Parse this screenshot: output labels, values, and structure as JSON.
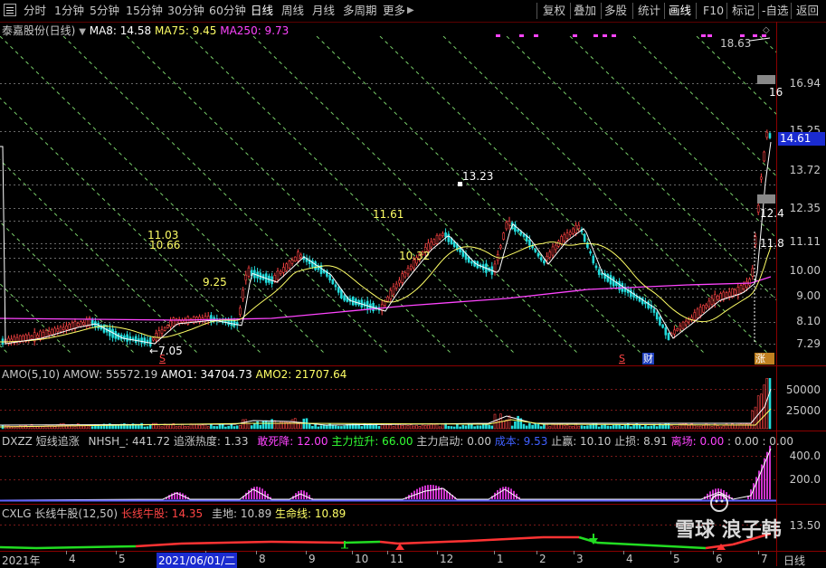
{
  "toolbar": {
    "menu_icon": "menu-icon",
    "periods": [
      "分时",
      "1分钟",
      "5分钟",
      "15分钟",
      "30分钟",
      "60分钟",
      "日线",
      "周线",
      "月线",
      "多周期",
      "更多"
    ],
    "active_period": "日线",
    "more_chevron": "chevron-right-icon",
    "right_buttons": [
      "复权",
      "叠加",
      "多股",
      "统计",
      "画线",
      "F10",
      "标记",
      "-自选",
      "返回"
    ],
    "active_right": "画线"
  },
  "main_panel": {
    "stock_title": "泰嘉股份(日线)",
    "ma8": "MA8: 14.58",
    "ma75": "MA75: 9.45",
    "ma250": "MA250: 9.73",
    "price_labels": [
      "16.94",
      "15.25",
      "13.72",
      "12.35",
      "11.11",
      "10.00",
      "9.00",
      "8.10",
      "7.29"
    ],
    "current_price": "14.61",
    "annotations": {
      "high": "18.63",
      "h1323": "13.23",
      "h1161": "11.61",
      "h1103": "11.03",
      "h1066": "10.66",
      "h1032": "10.32",
      "h925": "9.25",
      "low": "7.05",
      "p16": "16",
      "p124": "12.4",
      "p118": "11.8"
    },
    "badges": [
      "S",
      "S",
      "财",
      "涨"
    ],
    "colors": {
      "ma8": "#ffffff",
      "ma75": "#ffff66",
      "ma250": "#ff44ff",
      "up": "#ff4444",
      "down": "#22dddd"
    }
  },
  "amo_panel": {
    "title": "AMO(5,10)",
    "amow": "AMOW: 55572.19",
    "amo1": "AMO1: 34704.73",
    "amo2": "AMO2: 21707.64",
    "ticks": [
      "50000",
      "25000"
    ]
  },
  "dxzz_panel": {
    "title": "DXZZ 短线追涨",
    "nhsh": "NHSH_: 441.72",
    "heat": "追涨热度: 1.33",
    "dead_drop": "敢死降: 12.00",
    "main_pull": "主力拉升: 66.00",
    "main_start": "主力启动: 0.00",
    "cost": "成本: 9.53",
    "take_profit": "止赢: 10.10",
    "stop_loss": "止损: 8.91",
    "leave": "离场: 0.00",
    "zeros": ": 0.00 : 0.00",
    "ticks": [
      "400.0",
      "200.0"
    ]
  },
  "cxlg_panel": {
    "title": "CXLG 长线牛股(12,50)",
    "bull": "长线牛股: 14.35",
    "ground": "圭地: 10.89",
    "life": "生命线: 10.89",
    "ticks": [
      "13.50"
    ]
  },
  "x_axis": {
    "labels": [
      "2021年",
      "4",
      "5",
      "2021/06/01/二",
      "8",
      "9",
      "10",
      "11",
      "12",
      "1",
      "2",
      "3",
      "4",
      "5",
      "6",
      "7"
    ],
    "right": "日线"
  },
  "watermark": "雪球 浪子韩"
}
